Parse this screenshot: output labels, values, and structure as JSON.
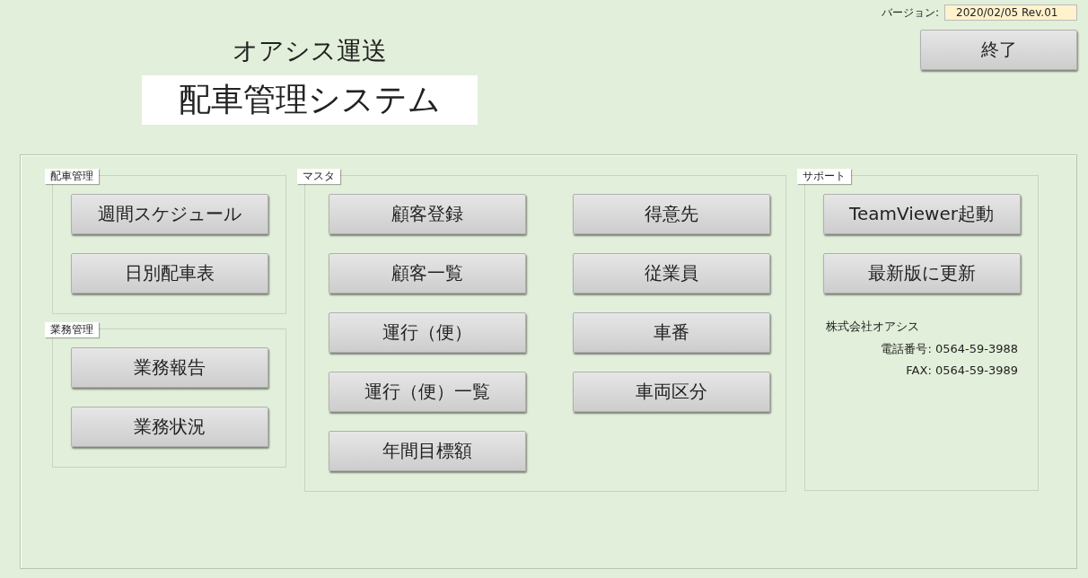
{
  "header": {
    "company": "オアシス運送",
    "system_title": "配車管理システム",
    "version_label": "バージョン:",
    "version": "2020/02/05 Rev.01",
    "exit_button": "終了"
  },
  "left_groups": [
    {
      "title": "配車管理",
      "columns": [
        [
          "週間スケジュール",
          "日別配車表"
        ]
      ]
    },
    {
      "title": "業務管理",
      "columns": [
        [
          "業務報告",
          "業務状況"
        ]
      ]
    }
  ],
  "master_group": {
    "title": "マスタ",
    "columns": [
      [
        "顧客登録",
        "顧客一覧",
        "運行（便）",
        "運行（便）一覧",
        "年間目標額"
      ],
      [
        "得意先",
        "従業員",
        "車番",
        "車両区分"
      ]
    ]
  },
  "support_group": {
    "title": "サポート",
    "columns": [
      [
        "TeamViewer起動",
        "最新版に更新"
      ]
    ],
    "company": "株式会社オアシス",
    "contacts": [
      "電話番号: 0564-59-3988",
      "FAX: 0564-59-3989"
    ]
  }
}
